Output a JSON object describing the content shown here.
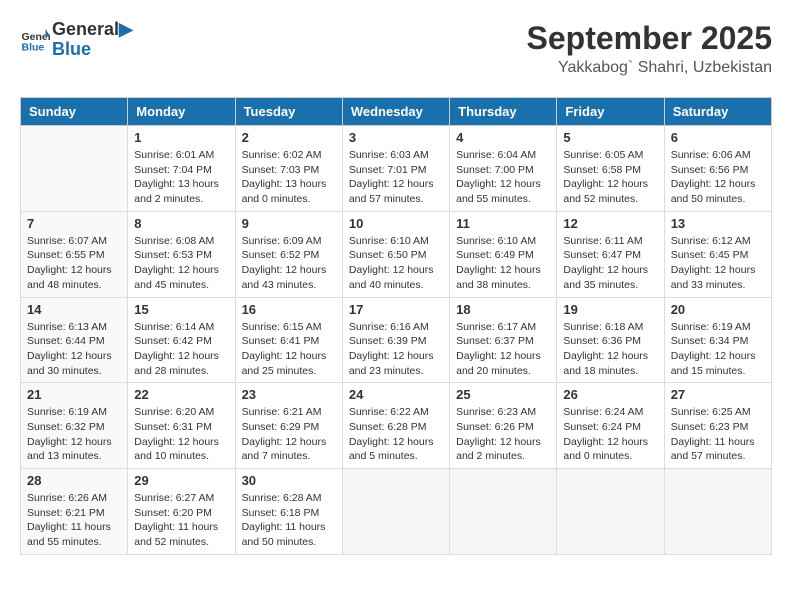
{
  "header": {
    "logo_line1": "General",
    "logo_line2": "Blue",
    "month_title": "September 2025",
    "subtitle": "Yakkabog` Shahri, Uzbekistan"
  },
  "weekdays": [
    "Sunday",
    "Monday",
    "Tuesday",
    "Wednesday",
    "Thursday",
    "Friday",
    "Saturday"
  ],
  "weeks": [
    [
      {
        "day": "",
        "empty": true
      },
      {
        "day": "1",
        "sunrise": "6:01 AM",
        "sunset": "7:04 PM",
        "daylight": "13 hours and 2 minutes."
      },
      {
        "day": "2",
        "sunrise": "6:02 AM",
        "sunset": "7:03 PM",
        "daylight": "13 hours and 0 minutes."
      },
      {
        "day": "3",
        "sunrise": "6:03 AM",
        "sunset": "7:01 PM",
        "daylight": "12 hours and 57 minutes."
      },
      {
        "day": "4",
        "sunrise": "6:04 AM",
        "sunset": "7:00 PM",
        "daylight": "12 hours and 55 minutes."
      },
      {
        "day": "5",
        "sunrise": "6:05 AM",
        "sunset": "6:58 PM",
        "daylight": "12 hours and 52 minutes."
      },
      {
        "day": "6",
        "sunrise": "6:06 AM",
        "sunset": "6:56 PM",
        "daylight": "12 hours and 50 minutes."
      }
    ],
    [
      {
        "day": "7",
        "sunrise": "6:07 AM",
        "sunset": "6:55 PM",
        "daylight": "12 hours and 48 minutes."
      },
      {
        "day": "8",
        "sunrise": "6:08 AM",
        "sunset": "6:53 PM",
        "daylight": "12 hours and 45 minutes."
      },
      {
        "day": "9",
        "sunrise": "6:09 AM",
        "sunset": "6:52 PM",
        "daylight": "12 hours and 43 minutes."
      },
      {
        "day": "10",
        "sunrise": "6:10 AM",
        "sunset": "6:50 PM",
        "daylight": "12 hours and 40 minutes."
      },
      {
        "day": "11",
        "sunrise": "6:10 AM",
        "sunset": "6:49 PM",
        "daylight": "12 hours and 38 minutes."
      },
      {
        "day": "12",
        "sunrise": "6:11 AM",
        "sunset": "6:47 PM",
        "daylight": "12 hours and 35 minutes."
      },
      {
        "day": "13",
        "sunrise": "6:12 AM",
        "sunset": "6:45 PM",
        "daylight": "12 hours and 33 minutes."
      }
    ],
    [
      {
        "day": "14",
        "sunrise": "6:13 AM",
        "sunset": "6:44 PM",
        "daylight": "12 hours and 30 minutes."
      },
      {
        "day": "15",
        "sunrise": "6:14 AM",
        "sunset": "6:42 PM",
        "daylight": "12 hours and 28 minutes."
      },
      {
        "day": "16",
        "sunrise": "6:15 AM",
        "sunset": "6:41 PM",
        "daylight": "12 hours and 25 minutes."
      },
      {
        "day": "17",
        "sunrise": "6:16 AM",
        "sunset": "6:39 PM",
        "daylight": "12 hours and 23 minutes."
      },
      {
        "day": "18",
        "sunrise": "6:17 AM",
        "sunset": "6:37 PM",
        "daylight": "12 hours and 20 minutes."
      },
      {
        "day": "19",
        "sunrise": "6:18 AM",
        "sunset": "6:36 PM",
        "daylight": "12 hours and 18 minutes."
      },
      {
        "day": "20",
        "sunrise": "6:19 AM",
        "sunset": "6:34 PM",
        "daylight": "12 hours and 15 minutes."
      }
    ],
    [
      {
        "day": "21",
        "sunrise": "6:19 AM",
        "sunset": "6:32 PM",
        "daylight": "12 hours and 13 minutes."
      },
      {
        "day": "22",
        "sunrise": "6:20 AM",
        "sunset": "6:31 PM",
        "daylight": "12 hours and 10 minutes."
      },
      {
        "day": "23",
        "sunrise": "6:21 AM",
        "sunset": "6:29 PM",
        "daylight": "12 hours and 7 minutes."
      },
      {
        "day": "24",
        "sunrise": "6:22 AM",
        "sunset": "6:28 PM",
        "daylight": "12 hours and 5 minutes."
      },
      {
        "day": "25",
        "sunrise": "6:23 AM",
        "sunset": "6:26 PM",
        "daylight": "12 hours and 2 minutes."
      },
      {
        "day": "26",
        "sunrise": "6:24 AM",
        "sunset": "6:24 PM",
        "daylight": "12 hours and 0 minutes."
      },
      {
        "day": "27",
        "sunrise": "6:25 AM",
        "sunset": "6:23 PM",
        "daylight": "11 hours and 57 minutes."
      }
    ],
    [
      {
        "day": "28",
        "sunrise": "6:26 AM",
        "sunset": "6:21 PM",
        "daylight": "11 hours and 55 minutes."
      },
      {
        "day": "29",
        "sunrise": "6:27 AM",
        "sunset": "6:20 PM",
        "daylight": "11 hours and 52 minutes."
      },
      {
        "day": "30",
        "sunrise": "6:28 AM",
        "sunset": "6:18 PM",
        "daylight": "11 hours and 50 minutes."
      },
      {
        "day": "",
        "empty": true
      },
      {
        "day": "",
        "empty": true
      },
      {
        "day": "",
        "empty": true
      },
      {
        "day": "",
        "empty": true
      }
    ]
  ],
  "labels": {
    "sunrise_prefix": "Sunrise: ",
    "sunset_prefix": "Sunset: ",
    "daylight_prefix": "Daylight: "
  }
}
